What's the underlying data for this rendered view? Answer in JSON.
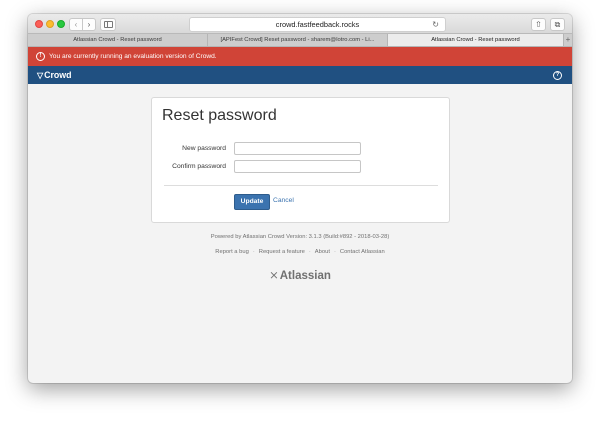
{
  "browser": {
    "url": "crowd.fastfeedback.rocks",
    "tabs": [
      {
        "label": "Atlassian Crowd - Reset password"
      },
      {
        "label": "[APIFest Crowd] Reset password - sharem@lotro.com - Li..."
      },
      {
        "label": "Atlassian Crowd - Reset password"
      }
    ],
    "new_tab": "+"
  },
  "banner": {
    "icon": "info-icon",
    "text": "You are currently running an evaluation version of Crowd.",
    "color": "#d04437"
  },
  "header": {
    "logo": "Crowd",
    "logo_icon": "crowd-icon",
    "help_icon": "help-icon",
    "color": "#205081"
  },
  "form": {
    "title": "Reset password",
    "new_password_label": "New password",
    "new_password_value": "",
    "confirm_password_label": "Confirm password",
    "confirm_password_value": "",
    "update_label": "Update",
    "cancel_label": "Cancel",
    "accent": "#3b73af"
  },
  "footer": {
    "powered_by": "Powered by Atlassian Crowd Version: 3.1.3 (Build:#892 - 2018-03-28)",
    "links": [
      "Report a bug",
      "Request a feature",
      "About",
      "Contact Atlassian"
    ],
    "logo": "Atlassian"
  }
}
